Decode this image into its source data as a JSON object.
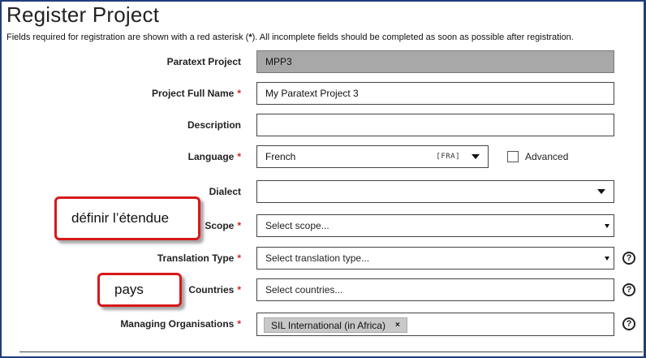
{
  "page": {
    "title": "Register Project",
    "instructions_before": "Fields required for registration are shown with a red asterisk (",
    "instructions_asterisk": "*",
    "instructions_after": "). All incomplete fields should be completed as soon as possible after registration."
  },
  "fields": {
    "paratext_project": {
      "label": "Paratext Project",
      "value": "MPP3"
    },
    "full_name": {
      "label": "Project Full Name",
      "required": "*",
      "value": "My Paratext Project 3"
    },
    "description": {
      "label": "Description",
      "value": ""
    },
    "language": {
      "label": "Language",
      "required": "*",
      "value": "French",
      "code": "[FRA]"
    },
    "advanced": {
      "label": "Advanced"
    },
    "dialect": {
      "label": "Dialect",
      "value": ""
    },
    "scope": {
      "label": "Scope",
      "required": "*",
      "placeholder": "Select scope..."
    },
    "translation_type": {
      "label": "Translation Type",
      "required": "*",
      "placeholder": "Select translation type..."
    },
    "countries": {
      "label": "Countries",
      "required": "*",
      "placeholder": "Select countries..."
    },
    "managing_orgs": {
      "label": "Managing Organisations",
      "required": "*",
      "tags": [
        {
          "label": "SIL International (in Africa)",
          "remove": "×"
        }
      ]
    }
  },
  "help_icon_glyph": "?",
  "callouts": {
    "scope": "définir l’étendue",
    "countries": "pays"
  },
  "colors": {
    "required": "#d9241b",
    "callout_border": "#d8181a",
    "frame_border": "#1f3e7d",
    "readonly_bg": "#a8a8a8"
  },
  "icons": {
    "dropdown": "chevron-down-icon",
    "help": "question-circle-icon",
    "remove_tag": "close-icon"
  }
}
